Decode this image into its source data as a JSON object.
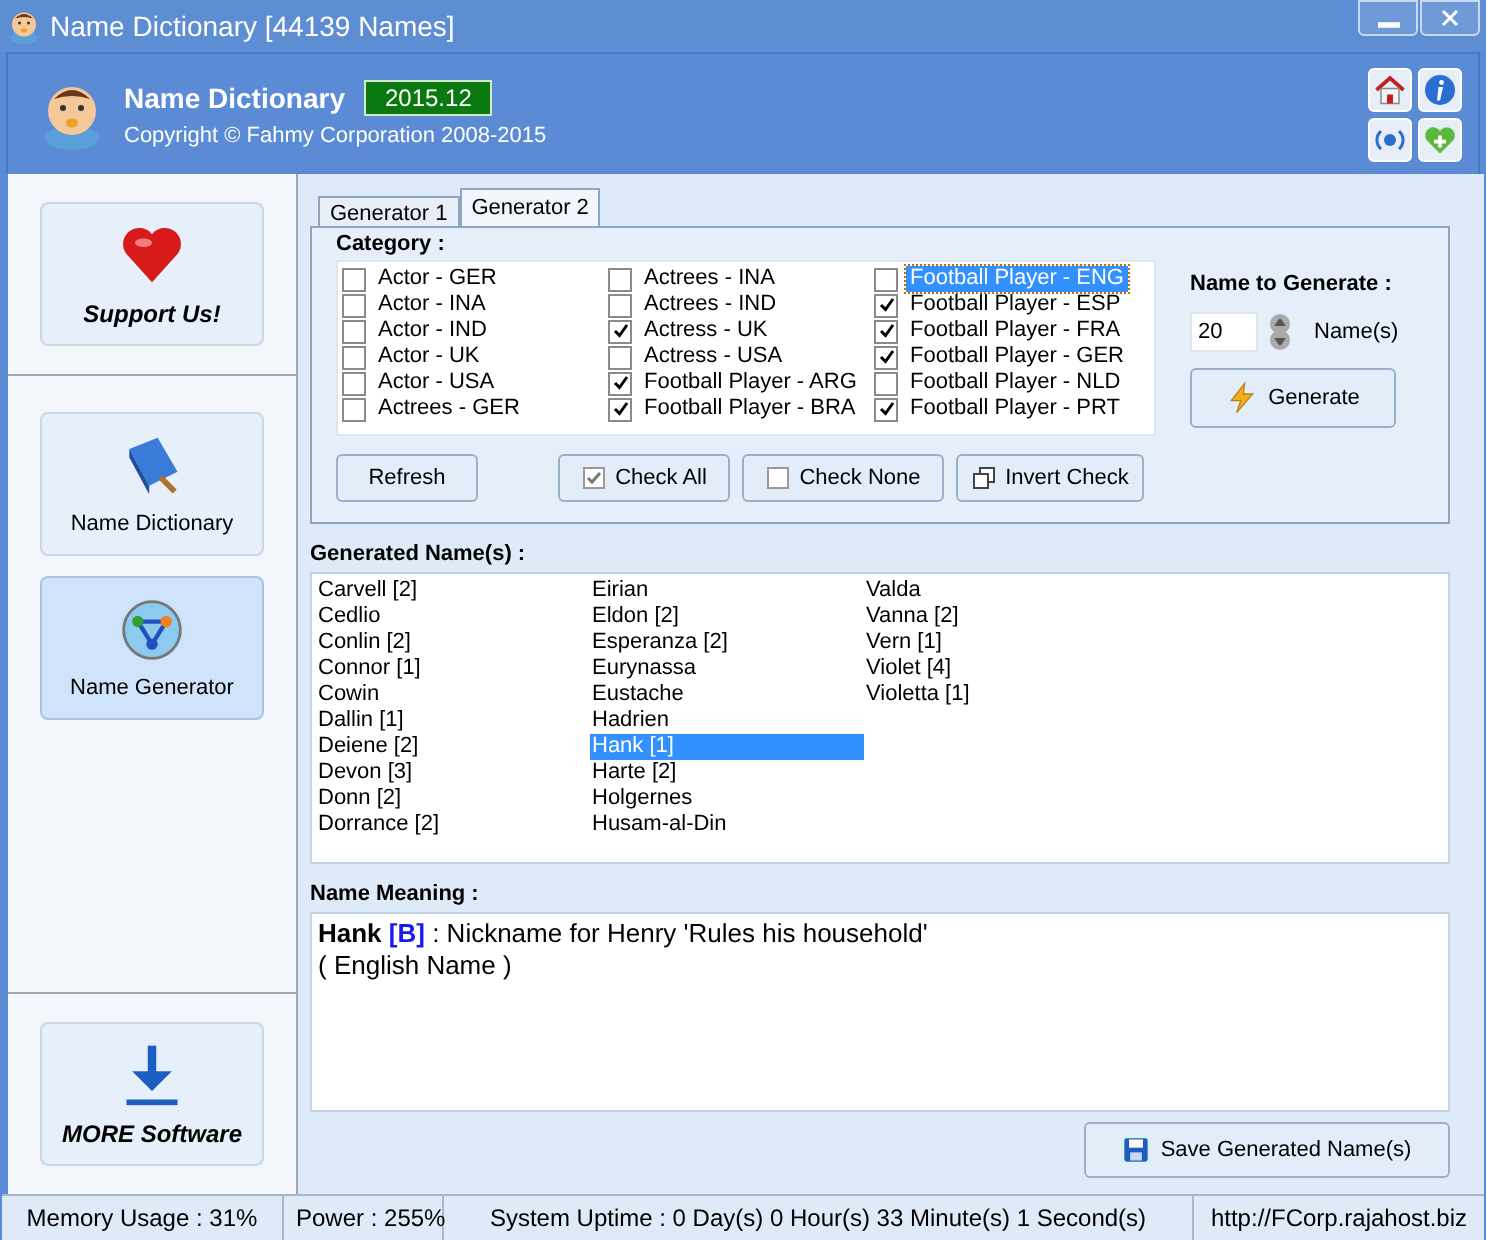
{
  "window": {
    "title": "Name Dictionary [44139 Names]"
  },
  "header": {
    "app_name": "Name Dictionary",
    "version": "2015.12",
    "copyright": "Copyright © Fahmy Corporation 2008-2015"
  },
  "sidebar": {
    "items": [
      {
        "label": "Support Us!",
        "kind": "support",
        "selected": false
      },
      {
        "label": "Name Dictionary",
        "kind": "dictionary",
        "selected": false
      },
      {
        "label": "Name Generator",
        "kind": "generator",
        "selected": true
      },
      {
        "label": "MORE Software",
        "kind": "more",
        "selected": false
      }
    ]
  },
  "tabs": [
    {
      "label": "Generator 1",
      "selected": false
    },
    {
      "label": "Generator 2",
      "selected": true
    }
  ],
  "category": {
    "label": "Category :",
    "items": [
      {
        "label": "Actor - GER",
        "checked": false,
        "selected": false
      },
      {
        "label": "Actor - INA",
        "checked": false,
        "selected": false
      },
      {
        "label": "Actor - IND",
        "checked": false,
        "selected": false
      },
      {
        "label": "Actor - UK",
        "checked": false,
        "selected": false
      },
      {
        "label": "Actor - USA",
        "checked": false,
        "selected": false
      },
      {
        "label": "Actrees - GER",
        "checked": false,
        "selected": false
      },
      {
        "label": "Actrees - INA",
        "checked": false,
        "selected": false
      },
      {
        "label": "Actrees - IND",
        "checked": false,
        "selected": false
      },
      {
        "label": "Actress - UK",
        "checked": true,
        "selected": false
      },
      {
        "label": "Actress - USA",
        "checked": false,
        "selected": false
      },
      {
        "label": "Football Player - ARG",
        "checked": true,
        "selected": false
      },
      {
        "label": "Football Player - BRA",
        "checked": true,
        "selected": false
      },
      {
        "label": "Football Player - ENG",
        "checked": false,
        "selected": true
      },
      {
        "label": "Football Player - ESP",
        "checked": true,
        "selected": false
      },
      {
        "label": "Football Player - FRA",
        "checked": true,
        "selected": false
      },
      {
        "label": "Football Player - GER",
        "checked": true,
        "selected": false
      },
      {
        "label": "Football Player - NLD",
        "checked": false,
        "selected": false
      },
      {
        "label": "Football Player - PRT",
        "checked": true,
        "selected": false
      }
    ],
    "buttons": [
      {
        "label": "Refresh",
        "kind": "plain"
      },
      {
        "label": "Check All",
        "kind": "check"
      },
      {
        "label": "Check None",
        "kind": "uncheck"
      },
      {
        "label": "Invert Check",
        "kind": "invert"
      }
    ]
  },
  "generate": {
    "label": "Name to Generate :",
    "value": "20",
    "unit": "Name(s)",
    "button": "Generate"
  },
  "generated": {
    "label": "Generated Name(s) :",
    "names": [
      {
        "text": "Carvell [2]",
        "selected": false
      },
      {
        "text": "Cedlio",
        "selected": false
      },
      {
        "text": "Conlin [2]",
        "selected": false
      },
      {
        "text": "Connor [1]",
        "selected": false
      },
      {
        "text": "Cowin",
        "selected": false
      },
      {
        "text": "Dallin [1]",
        "selected": false
      },
      {
        "text": "Deiene [2]",
        "selected": false
      },
      {
        "text": "Devon [3]",
        "selected": false
      },
      {
        "text": "Donn [2]",
        "selected": false
      },
      {
        "text": "Dorrance [2]",
        "selected": false
      },
      {
        "text": "Eirian",
        "selected": false
      },
      {
        "text": "Eldon [2]",
        "selected": false
      },
      {
        "text": "Esperanza [2]",
        "selected": false
      },
      {
        "text": "Eurynassa",
        "selected": false
      },
      {
        "text": "Eustache",
        "selected": false
      },
      {
        "text": "Hadrien",
        "selected": false
      },
      {
        "text": "Hank [1]",
        "selected": true
      },
      {
        "text": "Harte [2]",
        "selected": false
      },
      {
        "text": "Holgernes",
        "selected": false
      },
      {
        "text": "Husam-al-Din",
        "selected": false
      },
      {
        "text": "Valda",
        "selected": false
      },
      {
        "text": "Vanna [2]",
        "selected": false
      },
      {
        "text": "Vern [1]",
        "selected": false
      },
      {
        "text": "Violet [4]",
        "selected": false
      },
      {
        "text": "Violetta [1]",
        "selected": false
      }
    ]
  },
  "meaning": {
    "label": "Name Meaning :",
    "name": "Hank",
    "tag": "[B]",
    "description": ": Nickname for Henry 'Rules his household'",
    "origin": "( English Name )"
  },
  "save_button": "Save Generated Name(s)",
  "status_bar": [
    "Memory Usage : 31%",
    "Power : 255%",
    "System Uptime : 0 Day(s) 0 Hour(s) 33 Minute(s) 1 Second(s)",
    "http://FCorp.rajahost.biz"
  ]
}
